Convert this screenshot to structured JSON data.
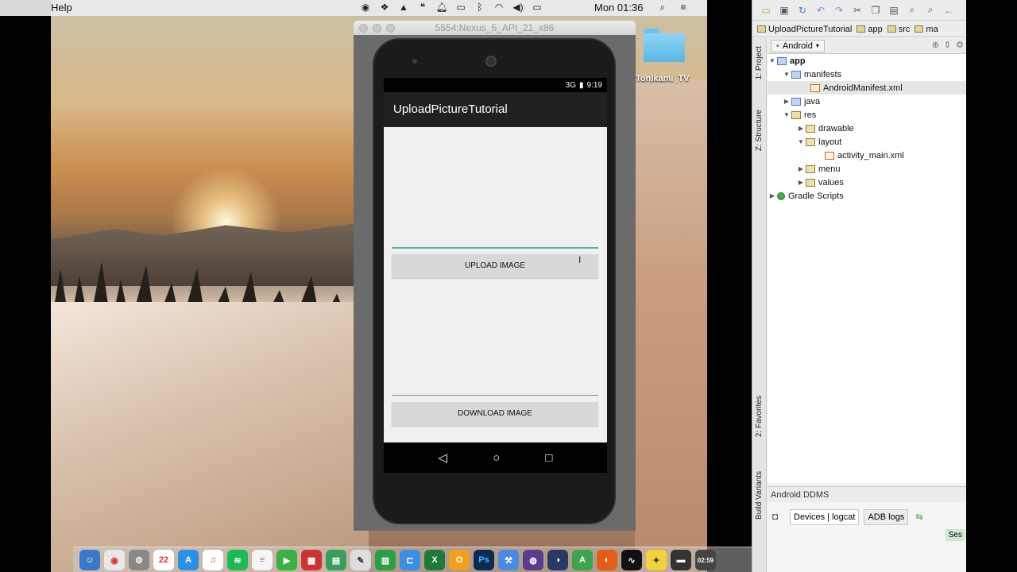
{
  "menubar": {
    "app_menu": "Help",
    "clock": "Mon 01:36"
  },
  "emulator": {
    "window_title": "5554:Nexus_5_API_21_x86",
    "status_time": "9:19",
    "status_signal": "3G",
    "app_title": "UploadPictureTutorial",
    "upload_button": "UPLOAD IMAGE",
    "download_button": "DOWNLOAD IMAGE"
  },
  "desktop": {
    "folder_label": "TonIkami_TV"
  },
  "dock": {
    "calendar_day": "22",
    "notification_badge": "3",
    "appstore_badge": "1",
    "clock_widget": "02:59"
  },
  "studio": {
    "breadcrumbs": [
      "UploadPictureTutorial",
      "app",
      "src",
      "ma"
    ],
    "view_selector": "Android",
    "side_tabs": {
      "project": "1: Project",
      "structure": "Z: Structure",
      "favorites": "2: Favorites",
      "build_variants": "Build Variants"
    },
    "tree": [
      {
        "label": "app",
        "depth": 0,
        "expanded": true,
        "icon": "module"
      },
      {
        "label": "manifests",
        "depth": 1,
        "expanded": true,
        "icon": "folder"
      },
      {
        "label": "AndroidManifest.xml",
        "depth": 2,
        "icon": "xml",
        "selected": true
      },
      {
        "label": "java",
        "depth": 1,
        "expanded": false,
        "icon": "folder"
      },
      {
        "label": "res",
        "depth": 1,
        "expanded": true,
        "icon": "res-folder"
      },
      {
        "label": "drawable",
        "depth": 2,
        "expanded": false,
        "icon": "folder"
      },
      {
        "label": "layout",
        "depth": 2,
        "expanded": true,
        "icon": "folder"
      },
      {
        "label": "activity_main.xml",
        "depth": 3,
        "icon": "xml"
      },
      {
        "label": "menu",
        "depth": 2,
        "expanded": false,
        "icon": "folder"
      },
      {
        "label": "values",
        "depth": 2,
        "expanded": false,
        "icon": "folder"
      },
      {
        "label": "Gradle Scripts",
        "depth": 0,
        "expanded": false,
        "icon": "gradle"
      }
    ],
    "ddms_title": "Android DDMS",
    "ddms_tabs": [
      "Devices | logcat",
      "ADB logs"
    ],
    "ddms_partial": "Ses"
  }
}
